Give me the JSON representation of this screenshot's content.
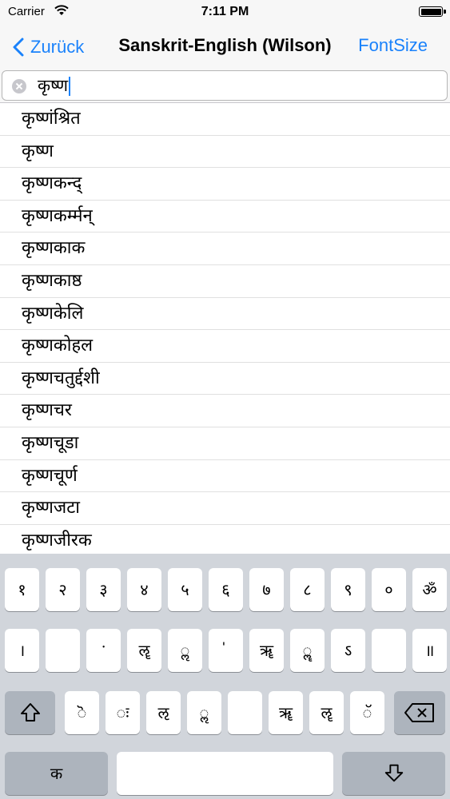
{
  "status_bar": {
    "carrier": "Carrier",
    "time": "7:11 PM"
  },
  "nav": {
    "back_label": "Zurück",
    "title": "Sanskrit-English (Wilson)",
    "font_size_label": "FontSize"
  },
  "search": {
    "value": "कृष्ण"
  },
  "results": [
    "कृष्णंश्रित",
    "कृष्ण",
    "कृष्णकन्द्",
    "कृष्णकर्म्मन्",
    "कृष्णकाक",
    "कृष्णकाष्ठ",
    "कृष्णकेलि",
    "कृष्णकोहल",
    "कृष्णचतुर्द्दशी",
    "कृष्णचर",
    "कृष्णचूडा",
    "कृष्णचूर्ण",
    "कृष्णजटा",
    "कृष्णजीरक"
  ],
  "keyboard": {
    "row1": [
      "१",
      "२",
      "३",
      "४",
      "५",
      "६",
      "७",
      "८",
      "९",
      "०",
      "ॐ"
    ],
    "row2": [
      "।",
      "",
      "ॱ",
      "ॡ",
      "ॢ",
      "॑",
      "ॠ",
      "ॣ",
      "ऽ",
      "",
      "॥"
    ],
    "row3": [
      "ॆ",
      "ः",
      "ऌ",
      "ॢ",
      "",
      "ॠ",
      "ॡ",
      "ॅ"
    ],
    "bottom": {
      "left_label": "क",
      "space_label": ""
    }
  }
}
